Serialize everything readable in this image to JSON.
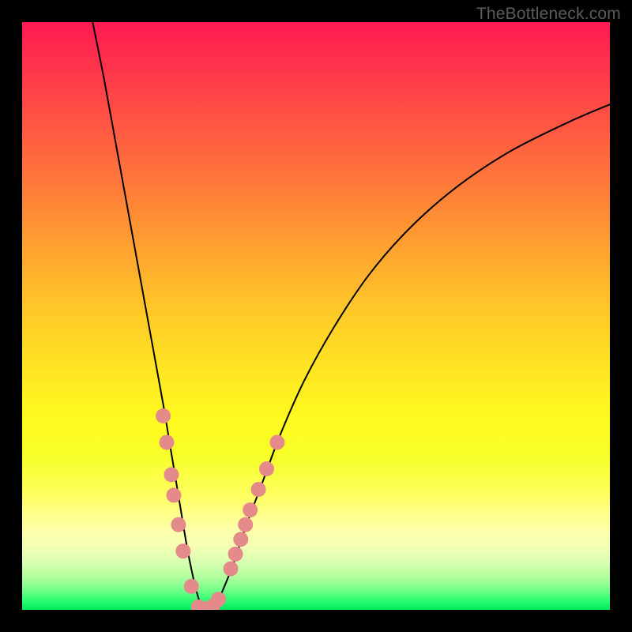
{
  "attribution": "TheBottleneck.com",
  "chart_data": {
    "type": "line",
    "title": "",
    "xlabel": "",
    "ylabel": "",
    "xlim": [
      0,
      100
    ],
    "ylim": [
      0,
      100
    ],
    "grid": false,
    "legend": false,
    "series": [
      {
        "name": "curve",
        "color": "#000000",
        "x": [
          12,
          14,
          16,
          18,
          20,
          22,
          24,
          25,
          26,
          27,
          28,
          29,
          30,
          31,
          32,
          33,
          34,
          36,
          38,
          41,
          44,
          48,
          53,
          59,
          66,
          74,
          83,
          93,
          100
        ],
        "y": [
          100,
          90,
          79,
          68,
          57,
          46,
          35,
          29,
          23,
          17,
          11,
          6,
          2,
          0,
          0,
          1,
          3,
          8,
          14,
          22,
          30,
          39,
          48,
          57,
          65,
          72,
          78,
          83,
          86
        ]
      },
      {
        "name": "markers-left",
        "color": "#e58a8a",
        "type": "scatter",
        "x": [
          24.0,
          24.6,
          25.4,
          25.8,
          26.6,
          27.4,
          28.8
        ],
        "y": [
          33.0,
          28.5,
          23.0,
          19.5,
          14.5,
          10.0,
          4.0
        ]
      },
      {
        "name": "markers-bottom",
        "color": "#e58a8a",
        "type": "scatter",
        "x": [
          30.0,
          30.8,
          31.6,
          32.4,
          33.4
        ],
        "y": [
          0.5,
          0.2,
          0.2,
          0.6,
          1.8
        ]
      },
      {
        "name": "markers-right",
        "color": "#e58a8a",
        "type": "scatter",
        "x": [
          35.5,
          36.3,
          37.2,
          38.0,
          38.8,
          40.2,
          41.6,
          43.4
        ],
        "y": [
          7.0,
          9.5,
          12.0,
          14.5,
          17.0,
          20.5,
          24.0,
          28.5
        ]
      }
    ]
  }
}
